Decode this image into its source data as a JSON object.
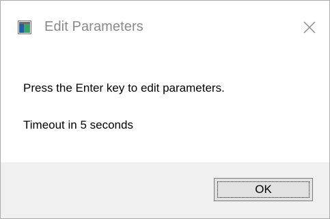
{
  "window": {
    "title": "Edit Parameters",
    "app_icon": "application-window-icon",
    "close_icon": "close-icon"
  },
  "content": {
    "message": "Press the Enter key to edit parameters.",
    "timeout": "Timeout in 5 seconds"
  },
  "footer": {
    "ok_label": "OK"
  },
  "colors": {
    "title_text": "#8a8a8a",
    "footer_bg": "#f0f0f0",
    "button_bg": "#e1e1e1",
    "button_border": "#7a7a7a",
    "icon_blue": "#1f5fa8",
    "icon_green": "#3aa36b"
  }
}
